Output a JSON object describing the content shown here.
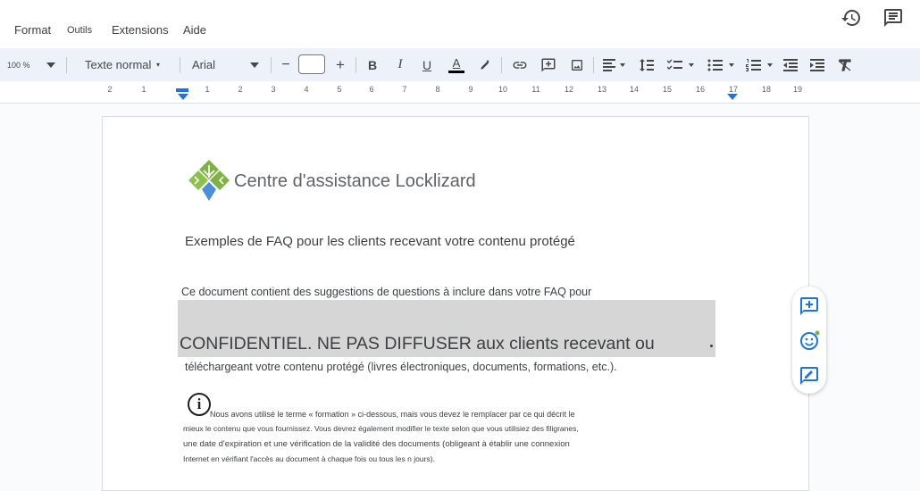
{
  "menu": {
    "items": [
      "Format",
      "Outils",
      "Extensions",
      "Aide"
    ]
  },
  "header_icons": [
    "history-icon",
    "comment-icon"
  ],
  "toolbar": {
    "zoom": "100 %",
    "style": "Texte normal",
    "font": "Arial",
    "font_size": "",
    "minus_symbol": "−",
    "plus_symbol": "+",
    "bold": "B",
    "italic": "I",
    "underline": "U",
    "text_color": "A"
  },
  "ruler": {
    "labels": [
      "2",
      "1",
      "1",
      "2",
      "3",
      "4",
      "5",
      "6",
      "7",
      "8",
      "9",
      "10",
      "11",
      "12",
      "13",
      "14",
      "15",
      "16",
      "17",
      "18",
      "19"
    ]
  },
  "document": {
    "title": "Centre d'assistance Locklizard",
    "subtitle": "Exemples de FAQ pour les clients recevant votre contenu protégé",
    "intro_line1": "Ce document contient des suggestions de questions à inclure dans votre FAQ pour",
    "watermark": "CONFIDENTIEL. NE PAS DIFFUSER aux clients recevant ou",
    "intro_line2": "téléchargeant votre contenu protégé (livres électroniques, documents, formations, etc.).",
    "info_icon_glyph": "i",
    "note_line1": "Nous avons utilisé le terme « formation » ci-dessous, mais vous devez le remplacer par ce qui décrit le",
    "note_line2": "mieux le contenu que vous fournissez. Vous devrez également modifier le texte selon que vous utilisiez des filigranes,",
    "note_line3": "une date d'expiration et une vérification de la validité des documents (obligeant à établir une connexion",
    "note_line4": "Internet en vérifiant l'accès au document à chaque fois ou tous les n jours)."
  },
  "colors": {
    "accent": "#1a73e8",
    "toolbar_bg": "#edf2fa",
    "logo_green": "#7cb342",
    "logo_blue": "#4a90d9",
    "highlight": "#d6d6d6"
  }
}
